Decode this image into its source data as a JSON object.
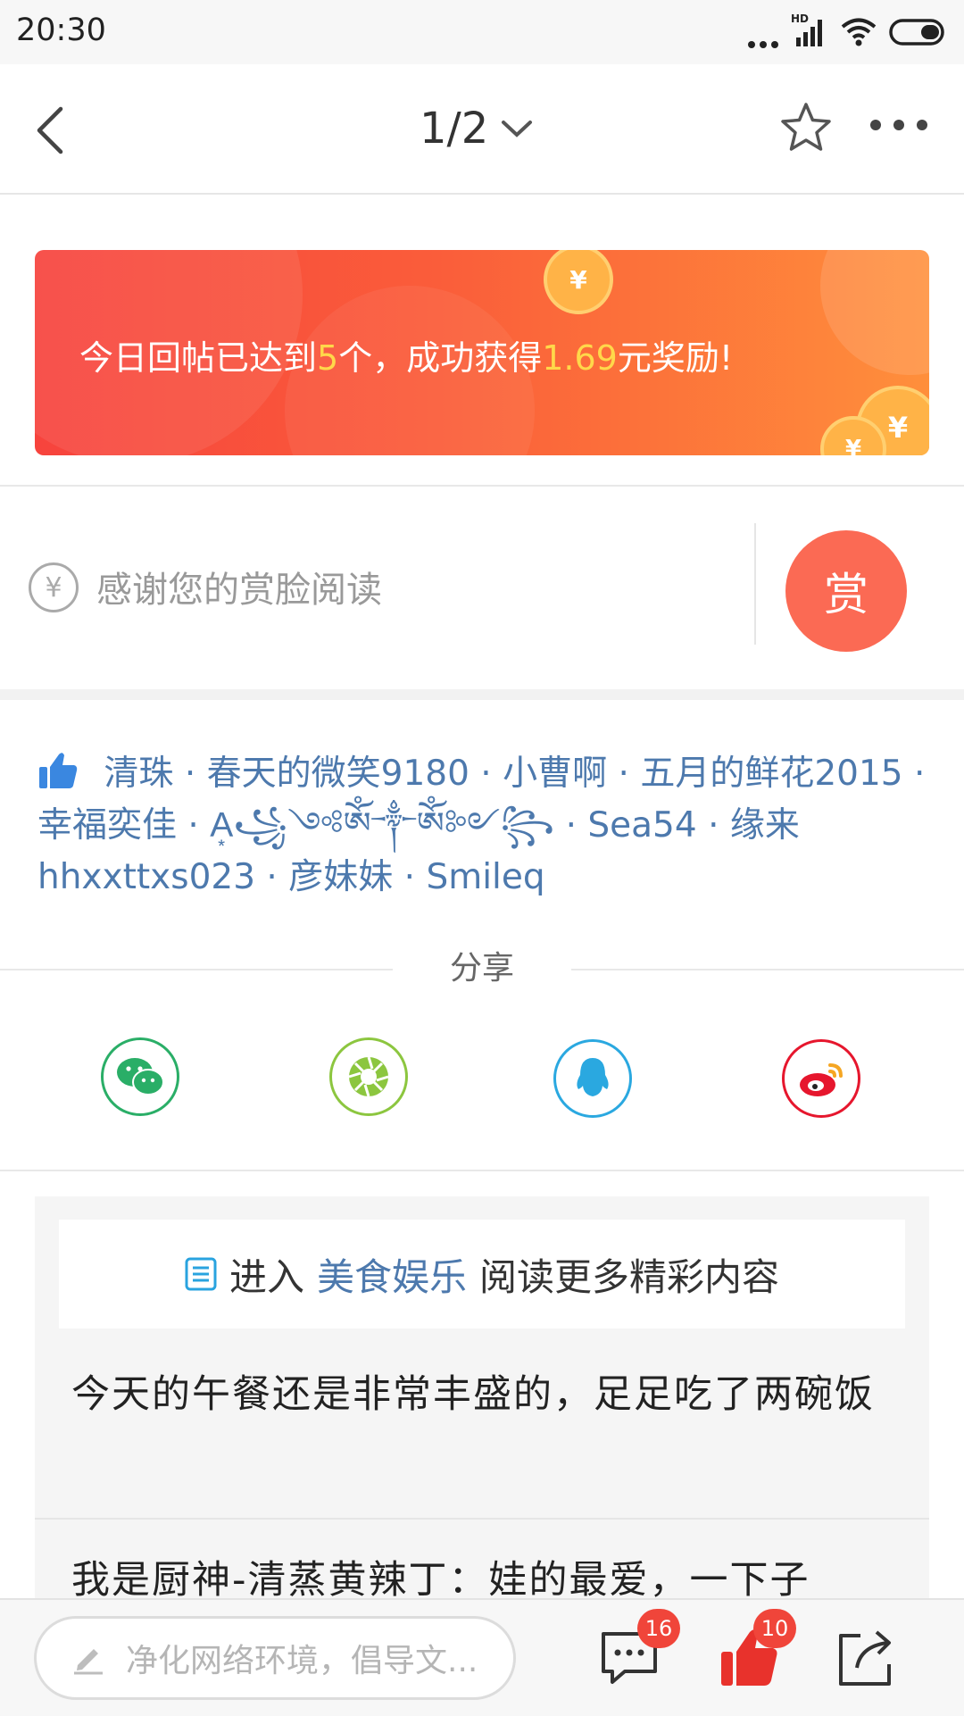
{
  "status_bar": {
    "time": "20:30",
    "network": "HD"
  },
  "nav": {
    "page_indicator": "1/2"
  },
  "banner": {
    "text_before": "今日回帖已达到",
    "count": "5",
    "text_middle": "个，成功获得",
    "amount": "1.69",
    "text_after": "元奖励!"
  },
  "reward": {
    "hint": "感谢您的赏脸阅读",
    "button_label": "赏",
    "currency_symbol": "¥"
  },
  "likers": [
    "清珠",
    "春天的微笑9180",
    "小曹啊",
    "五月的鲜花2015",
    "幸福奕佳",
    "A͙꧁༺ༀ༒ༀ༻꧂",
    "Sea54",
    "缘来hhxxttxs023",
    "彦妹妹",
    "Smileq"
  ],
  "share": {
    "title": "分享",
    "targets": [
      "wechat",
      "moments",
      "qq",
      "weibo"
    ]
  },
  "related": {
    "enter_prefix": "进入",
    "board_name": "美食娱乐",
    "enter_suffix": "阅读更多精彩内容",
    "posts": [
      "今天的午餐还是非常丰盛的，足足吃了两碗饭",
      "我是厨神-清蒸黄辣丁：娃的最爱，一下子"
    ]
  },
  "bottom_bar": {
    "comment_placeholder": "净化网络环境，倡导文...",
    "comment_count": "16",
    "like_count": "10"
  },
  "colors": {
    "accent_link": "#4d79ad",
    "reward_button": "#fb6a54",
    "badge": "#f0453a",
    "banner_highlight": "#ffd84a",
    "wechat": "#2aae67",
    "moments": "#8cc63f",
    "qq": "#2aa8e0",
    "weibo": "#e6162d"
  }
}
